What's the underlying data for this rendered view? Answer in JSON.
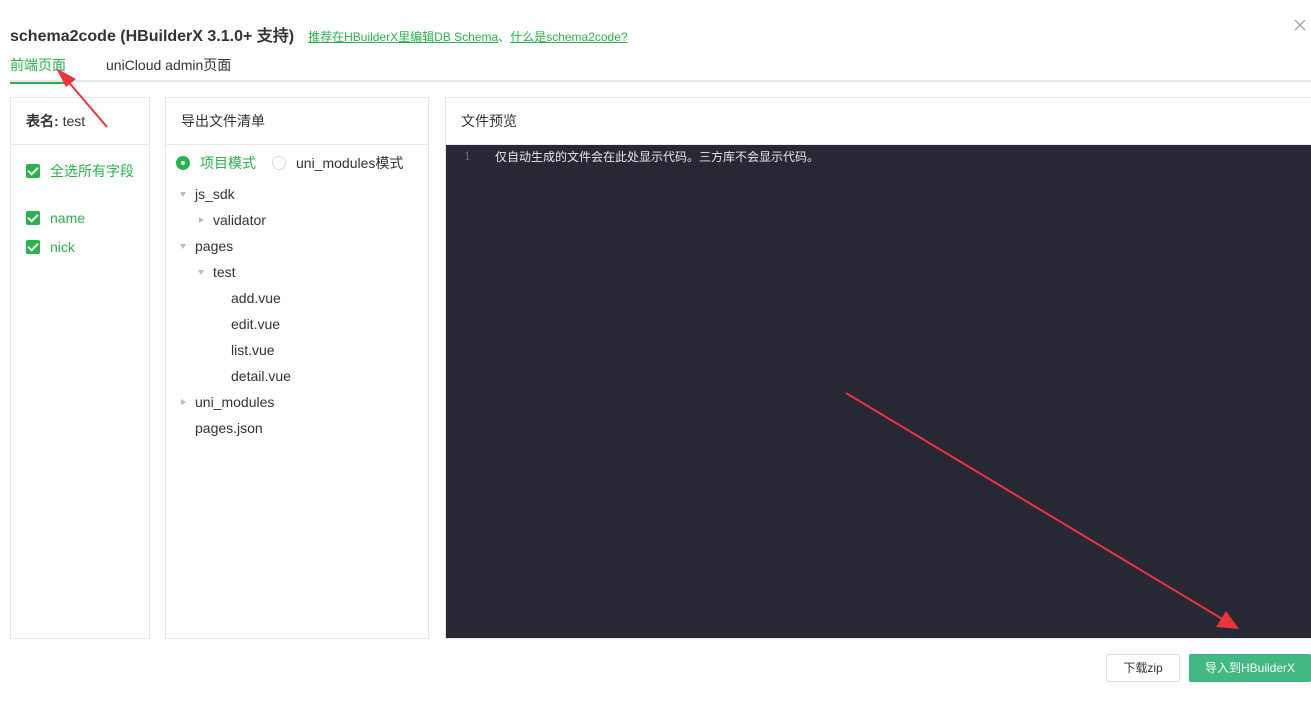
{
  "header": {
    "title": "schema2code (HBuilderX 3.1.0+ 支持)",
    "link1": "推荐在HBuilderX里编辑DB Schema",
    "separator": "、",
    "link2": "什么是schema2code?"
  },
  "close_icon": "close-icon",
  "tabs": [
    {
      "label": "前端页面",
      "active": true
    },
    {
      "label": "uniCloud admin页面",
      "active": false
    }
  ],
  "fields_panel": {
    "table_label": "表名:",
    "table_name": "test",
    "select_all": "全选所有字段",
    "fields": [
      "name",
      "nick"
    ]
  },
  "files_panel": {
    "title": "导出文件清单",
    "modes": [
      {
        "label": "项目模式",
        "selected": true
      },
      {
        "label": "uni_modules模式",
        "selected": false
      }
    ],
    "tree": [
      {
        "label": "js_sdk",
        "state": "expanded",
        "depth": 0
      },
      {
        "label": "validator",
        "state": "collapsed",
        "depth": 1
      },
      {
        "label": "pages",
        "state": "expanded",
        "depth": 0
      },
      {
        "label": "test",
        "state": "expanded",
        "depth": 1
      },
      {
        "label": "add.vue",
        "state": "leaf",
        "depth": 2
      },
      {
        "label": "edit.vue",
        "state": "leaf",
        "depth": 2
      },
      {
        "label": "list.vue",
        "state": "leaf",
        "depth": 2
      },
      {
        "label": "detail.vue",
        "state": "leaf",
        "depth": 2
      },
      {
        "label": "uni_modules",
        "state": "collapsed",
        "depth": 0
      },
      {
        "label": "pages.json",
        "state": "leaf",
        "depth": 0
      }
    ]
  },
  "preview_panel": {
    "title": "文件预览",
    "line_number": "1",
    "code": "仅自动生成的文件会在此处显示代码。三方库不会显示代码。"
  },
  "buttons": {
    "download": "下载zip",
    "import": "导入到HBuilderX"
  },
  "colors": {
    "accent": "#2bb24c",
    "button_green": "#42b983",
    "editor_bg": "#272833",
    "annotation_arrow": "#e8343a"
  }
}
